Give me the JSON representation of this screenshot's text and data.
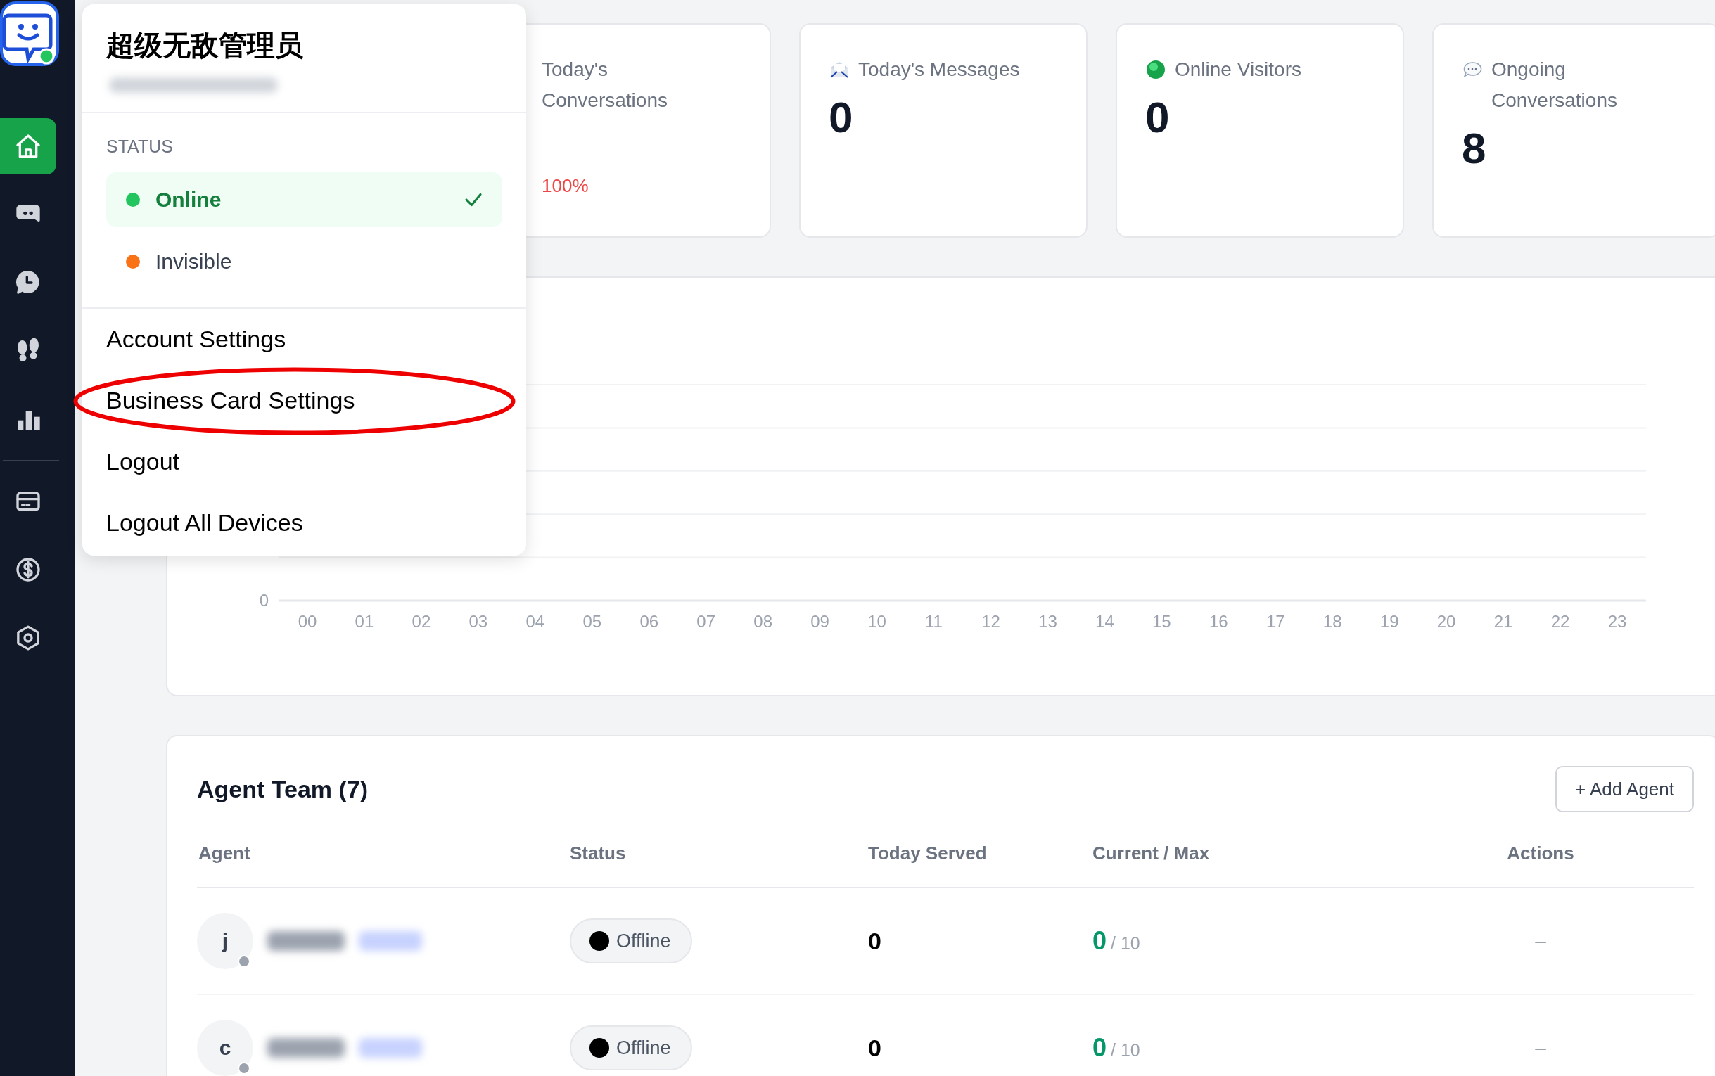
{
  "sidebar": {
    "top_items": [
      {
        "kind": "home",
        "selected": true
      },
      {
        "kind": "chat",
        "selected": false
      },
      {
        "kind": "history",
        "selected": false
      },
      {
        "kind": "footprints",
        "selected": false
      },
      {
        "kind": "chart",
        "selected": false
      }
    ],
    "bottom_items": [
      {
        "kind": "card",
        "selected": false
      },
      {
        "kind": "dollar",
        "selected": false
      },
      {
        "kind": "settings",
        "selected": false
      }
    ]
  },
  "stats": [
    {
      "kind": "conversations",
      "label": "Today's Conversations",
      "delta": "100%"
    },
    {
      "kind": "messages",
      "label": "Today's Messages",
      "value": "0"
    },
    {
      "kind": "visitors",
      "label": "Online Visitors",
      "value": "0"
    },
    {
      "kind": "ongoing",
      "label": "Ongoing Conversations",
      "value": "8"
    }
  ],
  "chart": {
    "y_labels": [
      "0"
    ],
    "x_labels": [
      "00",
      "01",
      "02",
      "03",
      "04",
      "05",
      "06",
      "07",
      "08",
      "09",
      "10",
      "11",
      "12",
      "13",
      "14",
      "15",
      "16",
      "17",
      "18",
      "19",
      "20",
      "21",
      "22",
      "23"
    ]
  },
  "team": {
    "title": "Agent Team (7)",
    "add_button": "+ Add Agent",
    "columns": [
      "Agent",
      "Status",
      "Today Served",
      "Current / Max",
      "Actions"
    ],
    "rows": [
      {
        "initial": "j",
        "status": "Offline",
        "online": false,
        "served": "0",
        "current": "0",
        "max": "/ 10",
        "actions": "–"
      },
      {
        "initial": "c",
        "status": "Offline",
        "online": false,
        "served": "0",
        "current": "0",
        "max": "/ 10",
        "actions": "–"
      }
    ]
  },
  "menu": {
    "name": "超级无敌管理员",
    "status_heading": "STATUS",
    "statuses": [
      {
        "label": "Online",
        "color": "#22c55e",
        "selected": true
      },
      {
        "label": "Invisible",
        "color": "#f97316",
        "selected": false
      }
    ],
    "items": [
      {
        "label": "Account Settings",
        "circled": false
      },
      {
        "label": "Business Card Settings",
        "circled": true
      },
      {
        "label": "Logout",
        "circled": false
      },
      {
        "label": "Logout All Devices",
        "circled": false
      }
    ]
  }
}
